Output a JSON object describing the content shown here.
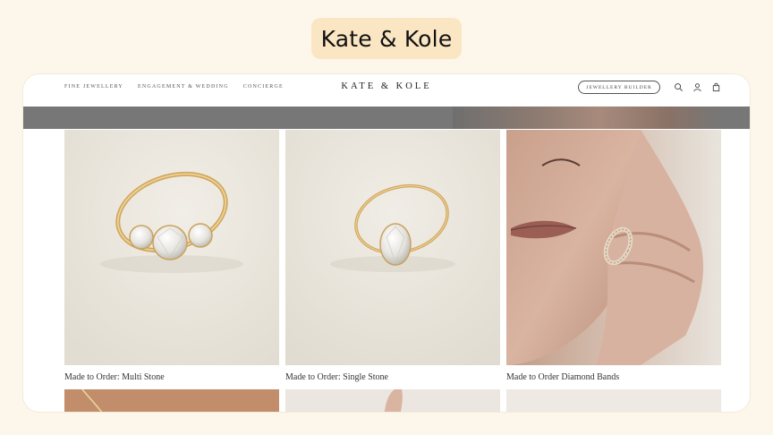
{
  "header": {
    "title": "Kate & Kole"
  },
  "site": {
    "logo": "KATE & KOLE",
    "nav": [
      {
        "label": "Fine Jewellery"
      },
      {
        "label": "Engagement & Wedding"
      },
      {
        "label": "Concierge"
      }
    ],
    "builder_button": "Jewellery Builder",
    "icons": [
      "search-icon",
      "account-icon",
      "bag-icon"
    ]
  },
  "products": [
    {
      "caption": "Made to Order: Multi Stone",
      "image": "three-stone-ring-image"
    },
    {
      "caption": "Made to Order: Single Stone",
      "image": "oval-solitaire-ring-image"
    },
    {
      "caption": "Made to Order Diamond Bands",
      "image": "model-wearing-diamond-band-image"
    }
  ],
  "colors": {
    "page_bg": "#fdf6ea",
    "title_chip": "#fbe6c4",
    "gold": "#d8b06a",
    "product_bg": "#ebe7de"
  }
}
